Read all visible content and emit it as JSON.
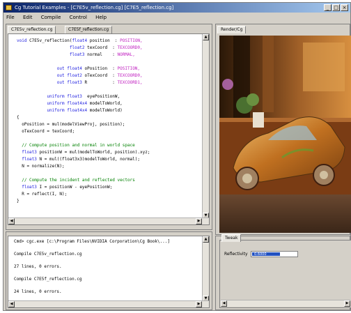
{
  "window": {
    "title": "Cg Tutorial Examples - [C7E5v_reflection.cg] [C7E5_reflection.cg]",
    "buttons": [
      "_",
      "□",
      "×"
    ]
  },
  "menu": [
    "File",
    "Edit",
    "Compile",
    "Control",
    "Help"
  ],
  "editor": {
    "tabs": [
      "C7E5v_reflection.cg",
      "C7E5f_reflection.cg"
    ],
    "code": [
      {
        "parts": [
          [
            "kw",
            "void "
          ],
          [
            "tx",
            "C7E5v_reflection("
          ],
          [
            "kw",
            "float4 "
          ],
          [
            "tx",
            "position  : "
          ],
          [
            "sem",
            "POSITION,"
          ]
        ]
      },
      {
        "parts": [
          [
            "kw",
            "                     float2 "
          ],
          [
            "tx",
            "texCoord  : "
          ],
          [
            "sem",
            "TEXCOORD0,"
          ]
        ]
      },
      {
        "parts": [
          [
            "kw",
            "                     float3 "
          ],
          [
            "tx",
            "normal    : "
          ],
          [
            "sem",
            "NORMAL,"
          ]
        ]
      },
      {
        "parts": [
          [
            "tx",
            ""
          ]
        ]
      },
      {
        "parts": [
          [
            "kw",
            "                out float4 "
          ],
          [
            "tx",
            "oPosition  : "
          ],
          [
            "sem",
            "POSITION,"
          ]
        ]
      },
      {
        "parts": [
          [
            "kw",
            "                out float2 "
          ],
          [
            "tx",
            "oTexCoord  : "
          ],
          [
            "sem",
            "TEXCOORD0,"
          ]
        ]
      },
      {
        "parts": [
          [
            "kw",
            "                out float3 "
          ],
          [
            "tx",
            "R          : "
          ],
          [
            "sem",
            "TEXCOORD1,"
          ]
        ]
      },
      {
        "parts": [
          [
            "tx",
            ""
          ]
        ]
      },
      {
        "parts": [
          [
            "kw",
            "            uniform float3  "
          ],
          [
            "tx",
            "eyePositionW,"
          ]
        ]
      },
      {
        "parts": [
          [
            "kw",
            "            uniform float4x4 "
          ],
          [
            "tx",
            "modelToWorld,"
          ]
        ]
      },
      {
        "parts": [
          [
            "kw",
            "            uniform float4x4 "
          ],
          [
            "tx",
            "modelToWorld)"
          ]
        ]
      },
      {
        "parts": [
          [
            "tx",
            "{"
          ]
        ]
      },
      {
        "parts": [
          [
            "tx",
            "  oPosition = mul(modelViewProj, position);"
          ]
        ]
      },
      {
        "parts": [
          [
            "tx",
            "  oTexCoord = texCoord;"
          ]
        ]
      },
      {
        "parts": [
          [
            "tx",
            ""
          ]
        ]
      },
      {
        "parts": [
          [
            "cm",
            "  // Compute position and normal in world space"
          ]
        ]
      },
      {
        "parts": [
          [
            "kw",
            "  float3 "
          ],
          [
            "tx",
            "positionW = mul(modelToWorld, position).xyz;"
          ]
        ]
      },
      {
        "parts": [
          [
            "kw",
            "  float3 "
          ],
          [
            "tx",
            "N = mul((float3x3)modelToWorld, normal);"
          ]
        ]
      },
      {
        "parts": [
          [
            "tx",
            "  N = normalize(N);"
          ]
        ]
      },
      {
        "parts": [
          [
            "tx",
            ""
          ]
        ]
      },
      {
        "parts": [
          [
            "cm",
            "  // Compute the incident and reflected vectors"
          ]
        ]
      },
      {
        "parts": [
          [
            "kw",
            "  float3 "
          ],
          [
            "tx",
            "I = positionW - eyePositionW;"
          ]
        ]
      },
      {
        "parts": [
          [
            "tx",
            "  R = reflect(I, N);"
          ]
        ]
      },
      {
        "parts": [
          [
            "tx",
            "}"
          ]
        ]
      }
    ]
  },
  "output": {
    "lines": [
      "Cmd> cgc.exe [c:\\Program Files\\NVIDIA Corporation\\Cg Book\\...]",
      "",
      "Compile C7E5v_reflection.cg",
      "",
      "27 lines, 0 errors.",
      "",
      "Compile C7E5f_reflection.cg",
      "",
      "24 lines, 0 errors."
    ]
  },
  "viewport": {
    "tab": "Render/Cg"
  },
  "tweak": {
    "tab": "Tweak",
    "slider_label": "Reflectivity",
    "slider_value": "0.6000",
    "slider_fraction": 0.62
  }
}
